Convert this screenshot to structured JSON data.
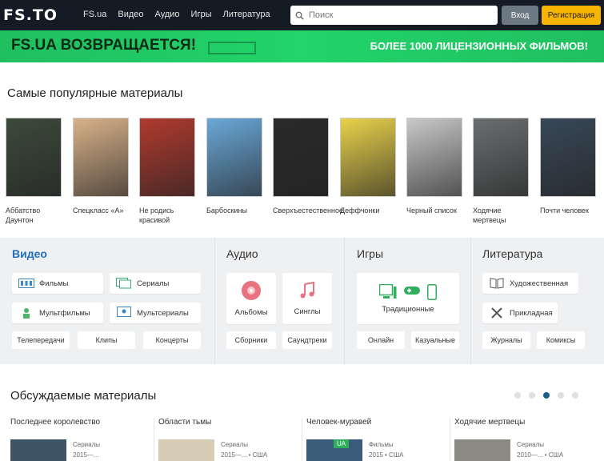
{
  "header": {
    "logo": "FS.TO",
    "nav": [
      "FS.ua",
      "Видео",
      "Аудио",
      "Игры",
      "Литература"
    ],
    "search_placeholder": "Поиск",
    "login": "Вход",
    "register": "Регистрация"
  },
  "banner": {
    "left": "FS.UA ВОЗВРАЩАЕТСЯ!",
    "right": "БОЛЕЕ 1000 ЛИЦЕНЗИОННЫХ ФИЛЬМОВ!"
  },
  "popular": {
    "title": "Самые популярные материалы",
    "items": [
      {
        "caption": "Аббатство Даунтон",
        "color": "#3c4a3a"
      },
      {
        "caption": "Спецкласс «А»",
        "color": "#d9b28a"
      },
      {
        "caption": "Не родись красивой",
        "color": "#b03a2e"
      },
      {
        "caption": "Барбоскины",
        "color": "#6aa8d8"
      },
      {
        "caption": "Сверхъестественное",
        "color": "#2a2a2a"
      },
      {
        "caption": "Деффчонки",
        "color": "#e9d24b"
      },
      {
        "caption": "Черный список",
        "color": "#c9c9c9"
      },
      {
        "caption": "Ходячие мертвецы",
        "color": "#6b6e70"
      },
      {
        "caption": "Почти человек",
        "color": "#384858"
      }
    ]
  },
  "categories": {
    "video": {
      "title": "Видео",
      "tiles": [
        "Фильмы",
        "Сериалы",
        "Мультфильмы",
        "Мультсериалы"
      ],
      "small": [
        "Телепередачи",
        "Клипы",
        "Концерты"
      ]
    },
    "audio": {
      "title": "Аудио",
      "tiles": [
        "Альбомы",
        "Синглы"
      ],
      "small": [
        "Сборники",
        "Саундтреки"
      ]
    },
    "games": {
      "title": "Игры",
      "tiles": [
        "Традиционные"
      ],
      "small": [
        "Онлайн",
        "Казуальные"
      ]
    },
    "lit": {
      "title": "Литература",
      "tiles": [
        "Художественная",
        "Прикладная"
      ],
      "small": [
        "Журналы",
        "Комиксы"
      ]
    }
  },
  "discussed": {
    "title": "Обсуждаемые материалы",
    "items": [
      {
        "title": "Последнее королевство",
        "type": "Сериалы",
        "meta": "2015—...",
        "thumb": "#3e5566"
      },
      {
        "title": "Области тьмы",
        "type": "Сериалы",
        "meta": "2015—...  •  США",
        "thumb": "#d7cdb7"
      },
      {
        "title": "Человек-муравей",
        "type": "Фильмы",
        "meta": "2015  •  США",
        "thumb": "#3a5b7a",
        "badge": "UA"
      },
      {
        "title": "Ходячие мертвецы",
        "type": "Сериалы",
        "meta": "2010—...  •  США",
        "thumb": "#8a8a82"
      }
    ]
  },
  "colors": {
    "topbar": "#141b24",
    "banner": "#22d46a",
    "accent_blue": "#1f6fc0",
    "register": "#f7b500"
  }
}
